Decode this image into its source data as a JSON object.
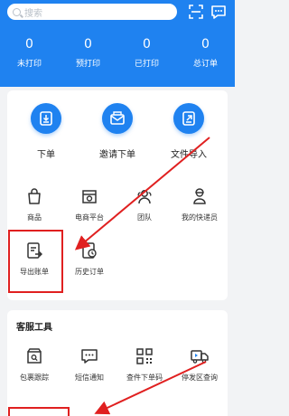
{
  "search": {
    "placeholder": "搜索"
  },
  "stats": [
    {
      "value": "0",
      "label": "未打印"
    },
    {
      "value": "0",
      "label": "预打印"
    },
    {
      "value": "0",
      "label": "已打印"
    },
    {
      "value": "0",
      "label": "总订单"
    }
  ],
  "main_actions": [
    {
      "label": "下单",
      "icon": "order-icon"
    },
    {
      "label": "邀请下单",
      "icon": "envelope-icon"
    },
    {
      "label": "文件导入",
      "icon": "file-import-icon"
    }
  ],
  "grid_items": [
    {
      "label": "商品",
      "icon": "shopping-bag-icon"
    },
    {
      "label": "电商平台",
      "icon": "store-icon"
    },
    {
      "label": "团队",
      "icon": "team-icon"
    },
    {
      "label": "我的快递员",
      "icon": "courier-icon"
    },
    {
      "label": "导出账单",
      "icon": "export-bill-icon"
    },
    {
      "label": "历史订单",
      "icon": "history-order-icon"
    }
  ],
  "service_tools": {
    "title": "客服工具",
    "items": [
      {
        "label": "包裹跟踪",
        "icon": "package-search-icon"
      },
      {
        "label": "短信通知",
        "icon": "sms-icon"
      },
      {
        "label": "查件下单码",
        "icon": "qr-code-icon"
      },
      {
        "label": "停发区查询",
        "icon": "truck-icon"
      }
    ]
  },
  "colors": {
    "primary": "#1f82f0",
    "background": "#f2f3f5",
    "annotation": "#e02020"
  }
}
